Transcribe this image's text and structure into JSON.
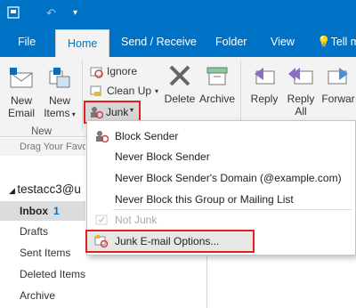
{
  "tabs": [
    "File",
    "Home",
    "Send / Receive",
    "Folder",
    "View",
    "Tell m"
  ],
  "ribbon": {
    "new_email": [
      "New",
      "Email"
    ],
    "new_items": [
      "New",
      "Items"
    ],
    "ignore": "Ignore",
    "clean_up": "Clean Up",
    "junk": "Junk",
    "delete": "Delete",
    "archive": "Archive",
    "reply": "Reply",
    "reply_all": [
      "Reply",
      "All"
    ],
    "forward": "Forwar",
    "group_new": "New"
  },
  "nav": {
    "hint": "Drag Your Favo",
    "account": "testacc3@u",
    "folders": [
      {
        "name": "Inbox",
        "count": "1"
      },
      {
        "name": "Drafts"
      },
      {
        "name": "Sent Items"
      },
      {
        "name": "Deleted Items"
      },
      {
        "name": "Archive"
      }
    ]
  },
  "menu": {
    "block_sender": "Block Sender",
    "never_block_sender": "Never Block Sender",
    "never_block_domain": "Never Block Sender's Domain (@example.com)",
    "never_block_group": "Never Block this Group or Mailing List",
    "not_junk": "Not Junk",
    "junk_options": "Junk E-mail Options..."
  }
}
